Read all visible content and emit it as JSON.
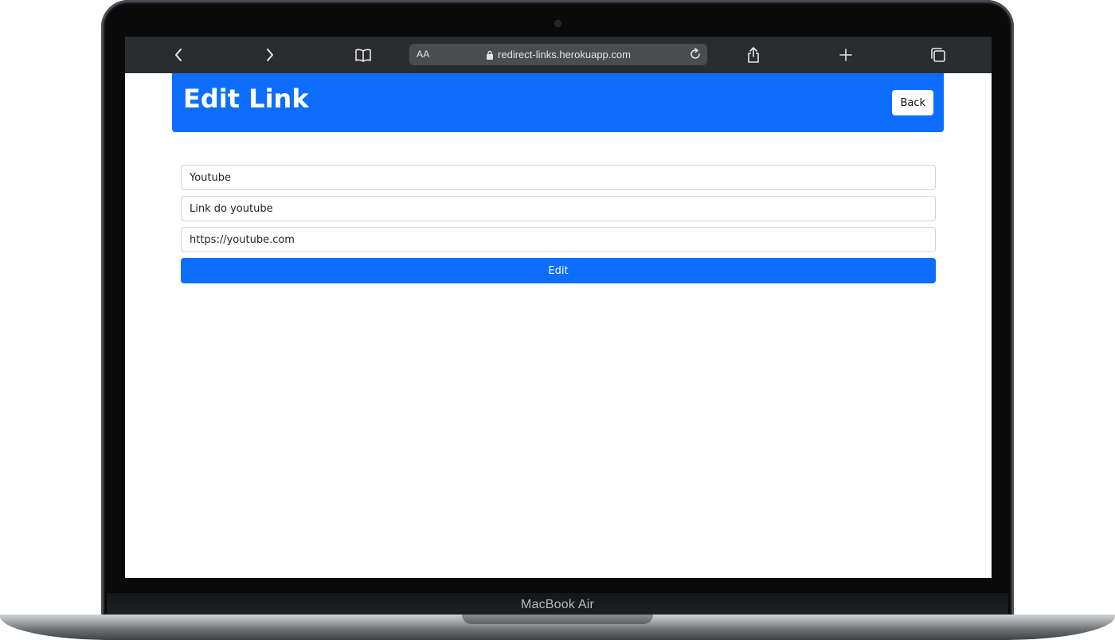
{
  "device": {
    "label": "MacBook Air"
  },
  "browser": {
    "text_size_label": "AA",
    "url": "redirect-links.herokuapp.com",
    "icons": {
      "back": "chevron-left-icon",
      "forward": "chevron-right-icon",
      "bookmarks": "book-icon",
      "lock": "lock-icon",
      "reload": "reload-icon",
      "share": "share-icon",
      "new_tab": "plus-icon",
      "tabs": "tabs-icon"
    }
  },
  "header": {
    "title": "Edit Link",
    "back_label": "Back",
    "background": "#0d6efd"
  },
  "form": {
    "name_value": "Youtube",
    "description_value": "Link do youtube",
    "url_value": "https://youtube.com",
    "submit_label": "Edit",
    "accent": "#0d6efd"
  }
}
